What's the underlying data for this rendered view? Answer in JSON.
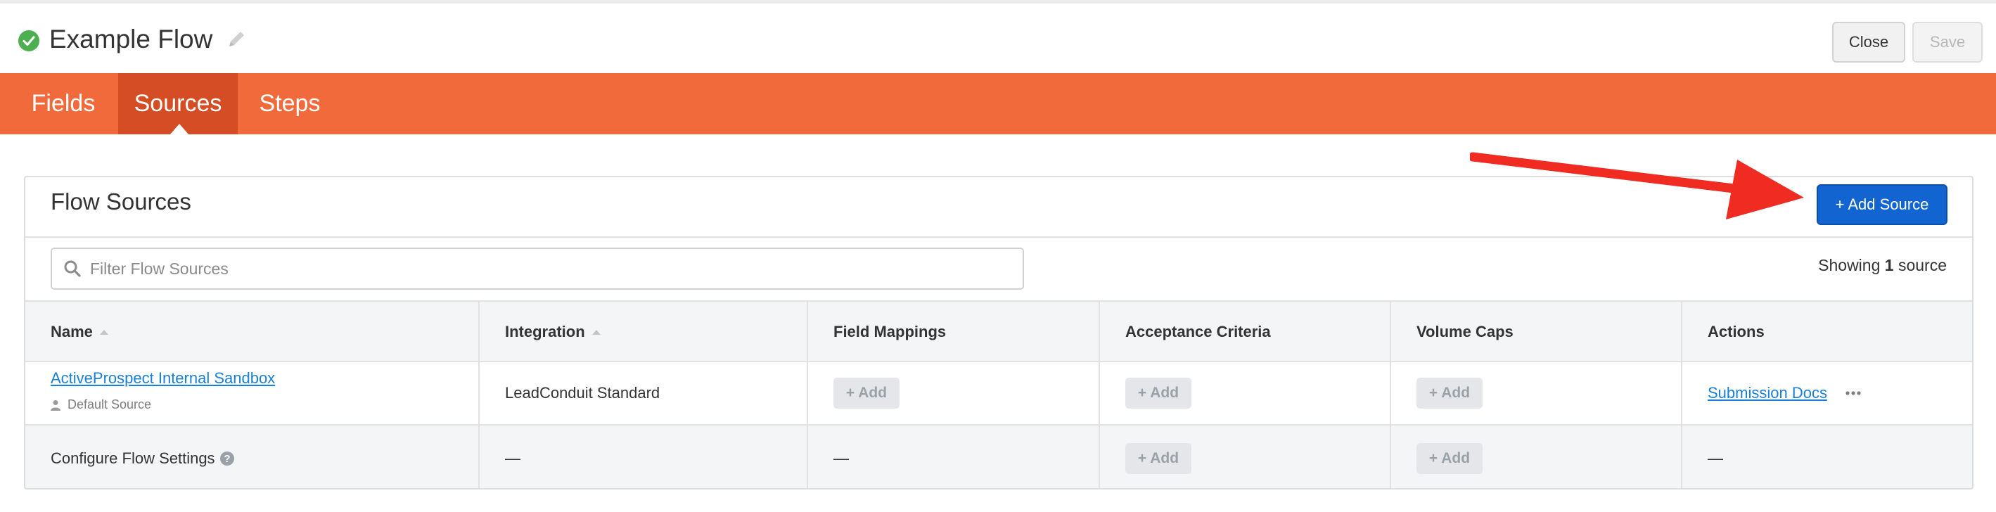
{
  "header": {
    "title": "Example Flow",
    "close_label": "Close",
    "save_label": "Save"
  },
  "nav": {
    "tabs": [
      {
        "label": "Fields",
        "active": false
      },
      {
        "label": "Sources",
        "active": true
      },
      {
        "label": "Steps",
        "active": false
      }
    ]
  },
  "panel": {
    "title": "Flow Sources",
    "add_source_label": "+ Add Source",
    "search_placeholder": "Filter Flow Sources",
    "showing_prefix": "Showing",
    "showing_count": "1",
    "showing_suffix": "source"
  },
  "table": {
    "headers": [
      "Name",
      "Integration",
      "Field Mappings",
      "Acceptance Criteria",
      "Volume Caps",
      "Actions"
    ],
    "rows": [
      {
        "name": "ActiveProspect Internal Sandbox",
        "subtitle": "Default Source",
        "integration": "LeadConduit Standard",
        "field_mappings": "+ Add",
        "acceptance_criteria": "+ Add",
        "volume_caps": "+ Add",
        "action_link": "Submission Docs"
      },
      {
        "name": "Configure Flow Settings",
        "integration": "—",
        "field_mappings": "—",
        "acceptance_criteria": "+ Add",
        "volume_caps": "+ Add",
        "actions": "—"
      }
    ]
  },
  "colors": {
    "nav_bg": "#f06a3b",
    "nav_active_bg": "#d44d25",
    "primary_button": "#1264d0",
    "link": "#1a7fd6",
    "success": "#4caf50",
    "annotation_arrow": "#ef2b22"
  },
  "icons": [
    "check-circle-icon",
    "pencil-icon",
    "search-icon",
    "person-icon",
    "more-horizontal-icon",
    "help-icon",
    "sort-caret-icon"
  ]
}
